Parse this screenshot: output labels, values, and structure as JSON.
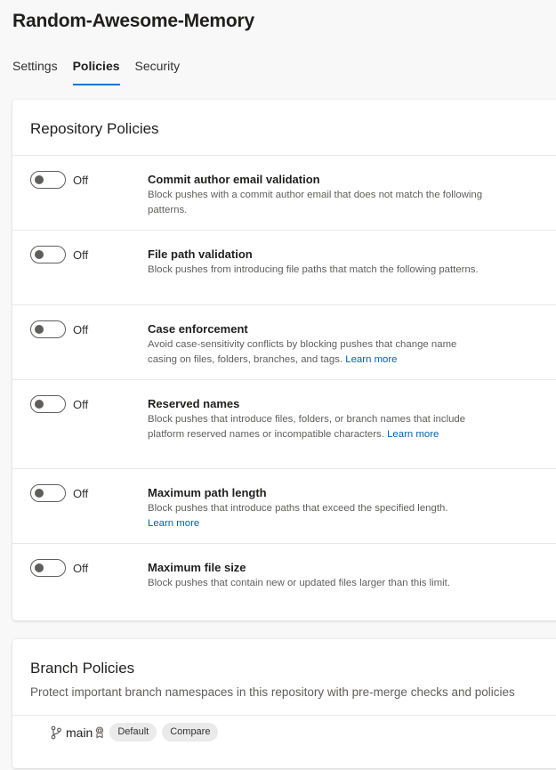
{
  "repo": {
    "title": "Random-Awesome-Memory"
  },
  "tabs": [
    {
      "label": "Settings",
      "active": false
    },
    {
      "label": "Policies",
      "active": true
    },
    {
      "label": "Security",
      "active": false
    }
  ],
  "repository_policies": {
    "title": "Repository Policies",
    "items": [
      {
        "toggle_state": "Off",
        "title": "Commit author email validation",
        "description": "Block pushes with a commit author email that does not match the following patterns.",
        "link": ""
      },
      {
        "toggle_state": "Off",
        "title": "File path validation",
        "description": "Block pushes from introducing file paths that match the following patterns.",
        "link": ""
      },
      {
        "toggle_state": "Off",
        "title": "Case enforcement",
        "description": "Avoid case-sensitivity conflicts by blocking pushes that change name casing on files, folders, branches, and tags.",
        "link": "Learn more"
      },
      {
        "toggle_state": "Off",
        "title": "Reserved names",
        "description": "Block pushes that introduce files, folders, or branch names that include platform reserved names or incompatible characters.",
        "link": "Learn more"
      },
      {
        "toggle_state": "Off",
        "title": "Maximum path length",
        "description": "Block pushes that introduce paths that exceed the specified length.",
        "link": "Learn more"
      },
      {
        "toggle_state": "Off",
        "title": "Maximum file size",
        "description": "Block pushes that contain new or updated files larger than this limit.",
        "link": ""
      }
    ]
  },
  "branch_policies": {
    "title": "Branch Policies",
    "description": "Protect important branch namespaces in this repository with pre-merge checks and policies",
    "branch": {
      "name": "main",
      "badge_default": "Default",
      "badge_compare": "Compare"
    }
  },
  "colors": {
    "accent": "#0078d4",
    "link": "#0063b1",
    "toggle_off": "#605e5c"
  }
}
